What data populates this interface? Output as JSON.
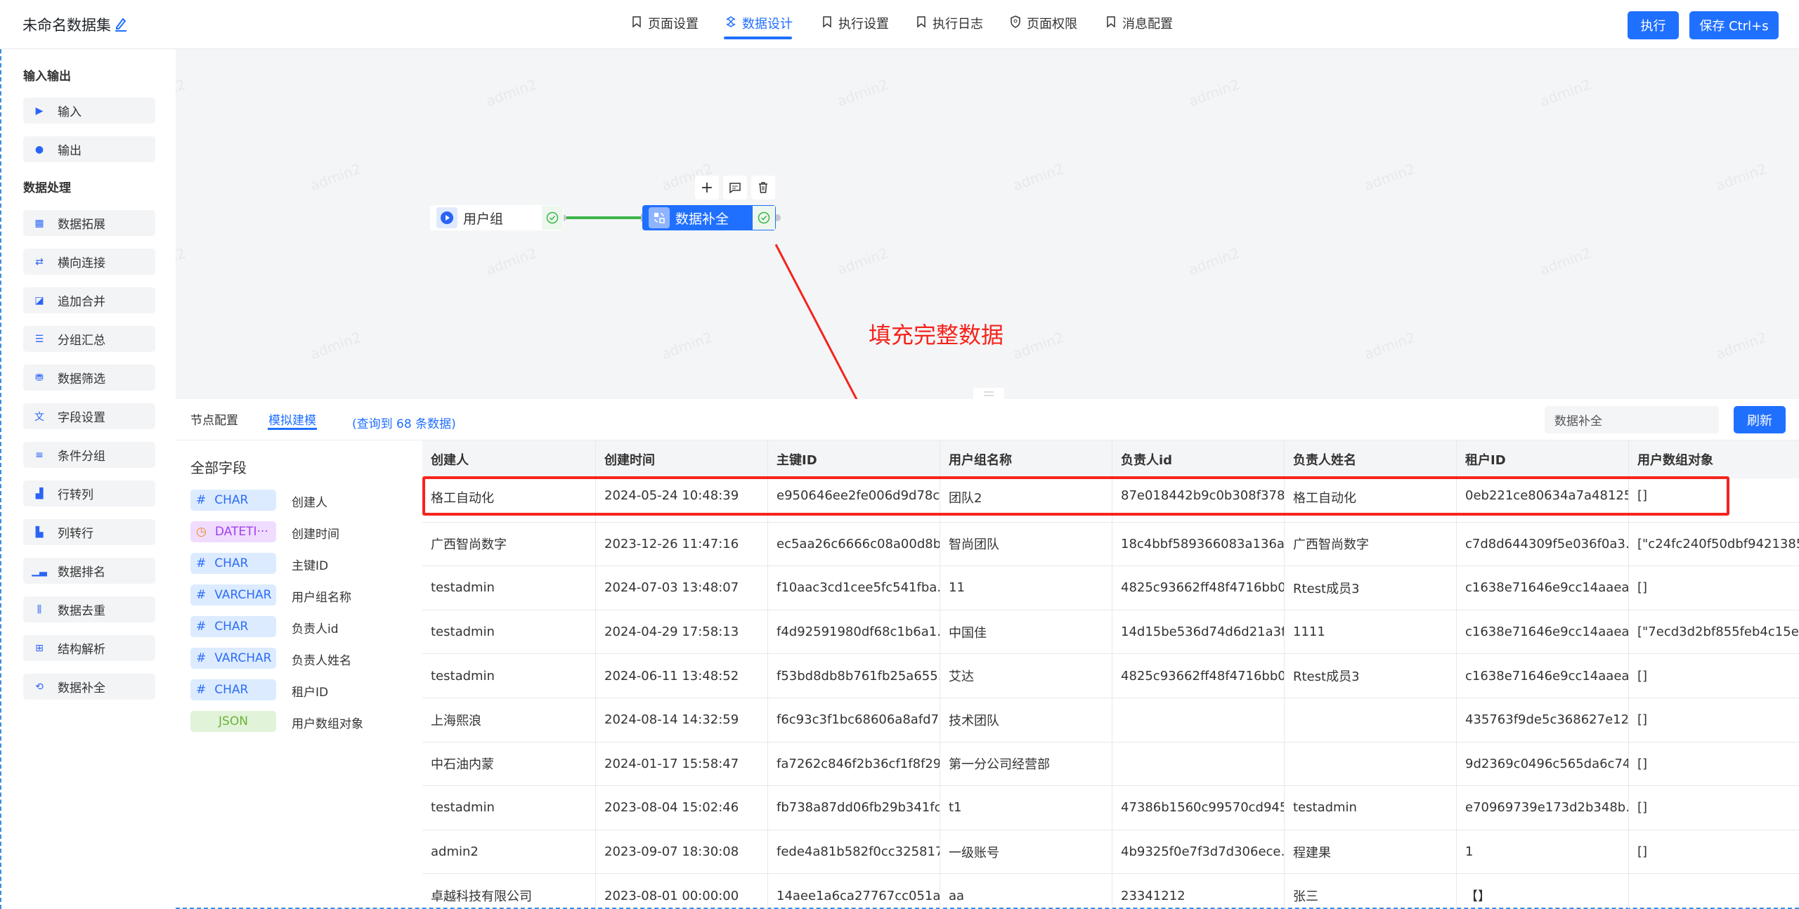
{
  "header": {
    "title": "未命名数据集",
    "tabs": [
      {
        "label": "页面设置",
        "icon": "bookmark-icon"
      },
      {
        "label": "数据设计",
        "icon": "design-icon",
        "active": true
      },
      {
        "label": "执行设置",
        "icon": "bookmark-icon"
      },
      {
        "label": "执行日志",
        "icon": "bookmark-icon"
      },
      {
        "label": "页面权限",
        "icon": "shield-icon"
      },
      {
        "label": "消息配置",
        "icon": "bookmark-icon"
      }
    ],
    "run_label": "执行",
    "save_label": "保存 Ctrl+s"
  },
  "sidebar": {
    "section_io": "输入输出",
    "io_items": [
      {
        "label": "输入",
        "icon": "play-icon"
      },
      {
        "label": "输出",
        "icon": "output-icon"
      }
    ],
    "section_proc": "数据处理",
    "proc_items": [
      {
        "label": "数据拓展",
        "icon": "expand-icon"
      },
      {
        "label": "横向连接",
        "icon": "join-icon"
      },
      {
        "label": "追加合并",
        "icon": "merge-icon"
      },
      {
        "label": "分组汇总",
        "icon": "group-icon"
      },
      {
        "label": "数据筛选",
        "icon": "filter-icon"
      },
      {
        "label": "字段设置",
        "icon": "translate-icon"
      },
      {
        "label": "条件分组",
        "icon": "condition-icon"
      },
      {
        "label": "行转列",
        "icon": "row-to-col-icon"
      },
      {
        "label": "列转行",
        "icon": "col-to-row-icon"
      },
      {
        "label": "数据排名",
        "icon": "rank-icon"
      },
      {
        "label": "数据去重",
        "icon": "dedupe-icon"
      },
      {
        "label": "结构解析",
        "icon": "parse-icon"
      },
      {
        "label": "数据补全",
        "icon": "complete-icon"
      }
    ]
  },
  "canvas": {
    "watermark": "admin2",
    "node_source": "用户组",
    "node_target": "数据补全",
    "annotation": "填充完整数据",
    "colors": {
      "primary": "#2070ff",
      "edge": "#3bb54a",
      "annotation": "#f5241c"
    }
  },
  "panel": {
    "tab_config": "节点配置",
    "tab_mock": "模拟建模",
    "query_info": "(查询到 68 条数据)",
    "search_value": "数据补全",
    "refresh_label": "刷新",
    "fields_title": "全部字段",
    "fields": [
      {
        "type": "CHAR",
        "name": "创建人",
        "kind": "char"
      },
      {
        "type": "DATETI···",
        "name": "创建时间",
        "kind": "datetime"
      },
      {
        "type": "CHAR",
        "name": "主键ID",
        "kind": "char"
      },
      {
        "type": "VARCHAR",
        "name": "用户组名称",
        "kind": "char"
      },
      {
        "type": "CHAR",
        "name": "负责人id",
        "kind": "char"
      },
      {
        "type": "VARCHAR",
        "name": "负责人姓名",
        "kind": "char"
      },
      {
        "type": "CHAR",
        "name": "租户ID",
        "kind": "char"
      },
      {
        "type": "JSON",
        "name": "用户数组对象",
        "kind": "json"
      }
    ],
    "table": {
      "columns": [
        "创建人",
        "创建时间",
        "主键ID",
        "用户组名称",
        "负责人id",
        "负责人姓名",
        "租户ID",
        "用户数组对象"
      ],
      "rows": [
        [
          "格工自动化",
          "2024-05-24 10:48:39",
          "e950646ee2fe006d9d78c…",
          "团队2",
          "87e018442b9c0b308f378…",
          "格工自动化",
          "0eb221ce80634a7a48125…",
          "[]"
        ],
        [
          "广西智尚数字",
          "2023-12-26 11:47:16",
          "ec5aa26c6666c08a00d8b…",
          "智尚团队",
          "18c4bbf589366083a136a…",
          "广西智尚数字",
          "c7d8d644309f5e036f0a3…",
          "[\"c24fc240f50dbf9421385…"
        ],
        [
          "testadmin",
          "2024-07-03 13:48:07",
          "f10aac3cd1cee5fc541fba…",
          "11",
          "4825c93662ff48f4716bb0…",
          "Rtest成员3",
          "c1638e71646e9cc14aaea…",
          "[]"
        ],
        [
          "testadmin",
          "2024-04-29 17:58:13",
          "f4d92591980df68c1b6a1…",
          "中国佳",
          "14d15be536d74d6d21a3f…",
          "1111",
          "c1638e71646e9cc14aaea…",
          "[\"7ecd3d2bf855feb4c15e…"
        ],
        [
          "testadmin",
          "2024-06-11 13:48:52",
          "f53bd8db8b761fb25a655…",
          "艾达",
          "4825c93662ff48f4716bb0…",
          "Rtest成员3",
          "c1638e71646e9cc14aaea…",
          "[]"
        ],
        [
          "上海熙浪",
          "2024-08-14 14:32:59",
          "f6c93c3f1bc68606a8afd7…",
          "技术团队",
          "",
          "",
          "435763f9de5c368627e12…",
          "[]"
        ],
        [
          "中石油内蒙",
          "2024-01-17 15:58:47",
          "fa7262c846f2b36cf1f8f29…",
          "第一分公司经营部",
          "",
          "",
          "9d2369c0496c565da6c74…",
          "[]"
        ],
        [
          "testadmin",
          "2023-08-04 15:02:46",
          "fb738a87dd06fb29b341fc…",
          "t1",
          "47386b1560c99570cd945…",
          "testadmin",
          "e70969739e173d2b348b…",
          "[]"
        ],
        [
          "admin2",
          "2023-09-07 18:30:08",
          "fede4a81b582f0cc325817…",
          "一级账号",
          "4b9325f0e7f3d7d306ece…",
          "程建果",
          "1",
          "[]"
        ],
        [
          "卓越科技有限公司",
          "2023-08-01 00:00:00",
          "14aee1a6ca27767cc051a…",
          "aa",
          "23341212",
          "张三",
          "【】",
          ""
        ]
      ]
    }
  }
}
